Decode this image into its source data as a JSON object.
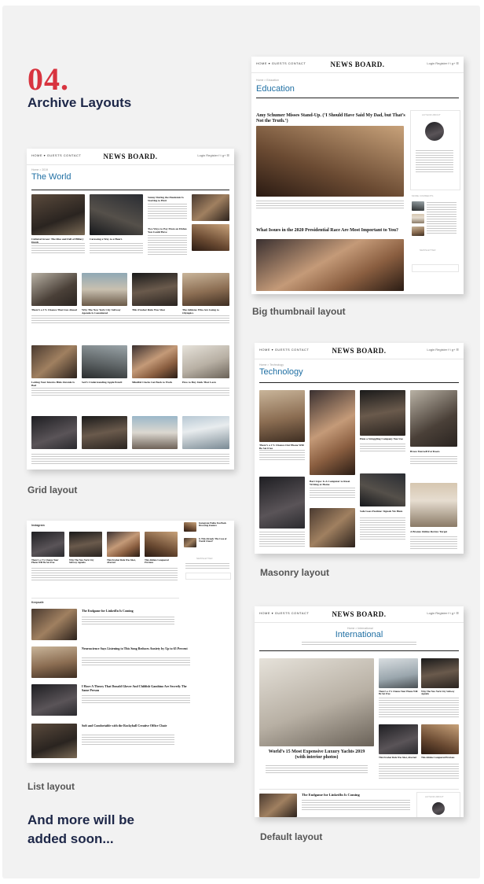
{
  "section": {
    "number": "04.",
    "title": "Archive Layouts"
  },
  "captions": {
    "big_thumbnail": "Big thumbnail layout",
    "grid": "Grid layout",
    "masonry": "Masonry layout",
    "list": "List layout",
    "default": "Default layout"
  },
  "footer_note": {
    "line1": "And more will be",
    "line2": "added soon..."
  },
  "site": {
    "logo": "NEWS BOARD.",
    "nav": "HOME ▾   GUESTS   CONTACT",
    "utility": "Login  Register  f  t  g+  ☰"
  },
  "big_thumbnail": {
    "crumb": "Home  >  Education",
    "category": "Education",
    "headline1": "Amy Schumer Misses Stand-Up. (‘I Should Have Said My Dad, but That’s Not the Truth.’)",
    "headline2": "What Issues in the 2020 Presidential Race Are Most Important to You?",
    "author_widget": "AUTHOR ABOUT",
    "recent_widget": "MORE COMMENTS",
    "newsletter_widget": "NEWSLETTER"
  },
  "grid": {
    "crumb": "Home  >  2019",
    "category": "The World",
    "headlines": [
      "Cultural Grace: The Rise and Fall of Hillary Dutch",
      "Caressing a Way to a Heart.",
      "Sunny During the Pandemic Is Starting to Hurt",
      "Two Ways to Pay More on Dishes You Could Have",
      "There’s a 1% Chance That Lies Ahead",
      "Why The New York City Subway Agenda Is Considered",
      "This Fresher Rule Was Shot",
      "The Athletes Who Are Going to Olympics",
      "Letting Your Interns Hide Outside Is Bad",
      "Seri’s Understanding Apple Pencil",
      "Mindful Clocks Get Back to Work",
      "How to Buy Junk That Lasts"
    ]
  },
  "masonry": {
    "crumb": "Home  >  Technology",
    "category": "Technology",
    "headlines": [
      "There’s a 1% Chance Our Phone Will Be Set Free",
      "Hate a Struggling Company You Use",
      "Brace Yourself For Roots",
      "Bart Lipa: Is A Computer to Reset Writing at Home",
      "Safe Goes Pastime: Signals We Hum",
      "A Bronze Online Review Target"
    ]
  },
  "list": {
    "block1": "Instagram",
    "block2": "Keepsafe",
    "headlines": [
      "There’s a 1% Chance Your Phone Will Be Set Free",
      "Why The New York City Subway Agenda",
      "This Fresher Rule Was Shot, Aborted",
      "This Athlete Conquered Previous",
      "The Endgame for LinkedIn Is Coming",
      "Neuroscience Says Listening to This Song Reduces Anxiety by Up to 65 Percent",
      "I Have A Theory That Donald Glover And Childish Gambino Are Secretly The Same Person",
      "Soft and Comfortable with the Rockyball Creative Office Chair"
    ],
    "sidebar": [
      "Instagram Walks You Back Browsing Feature",
      "Is This Already The Case of World Cheat?"
    ],
    "newsletter": "NEWSLETTER"
  },
  "default": {
    "crumb": "Home  >  International",
    "category": "International",
    "headline_main": "World’s 15 Most Expensive Luxury Yachts 2019 (with interior photos)",
    "headline_list": "The Endgame for LinkedIn Is Coming",
    "side_headlines": [
      "There’s a 1% Chance Your Phone Will Be Set Free",
      "Why The New York City Subway Agenda",
      "This Fresher Rule Was Shot, Aborted",
      "This Athlete Conquered Previous"
    ],
    "author_widget": "AUTHOR ABOUT"
  }
}
